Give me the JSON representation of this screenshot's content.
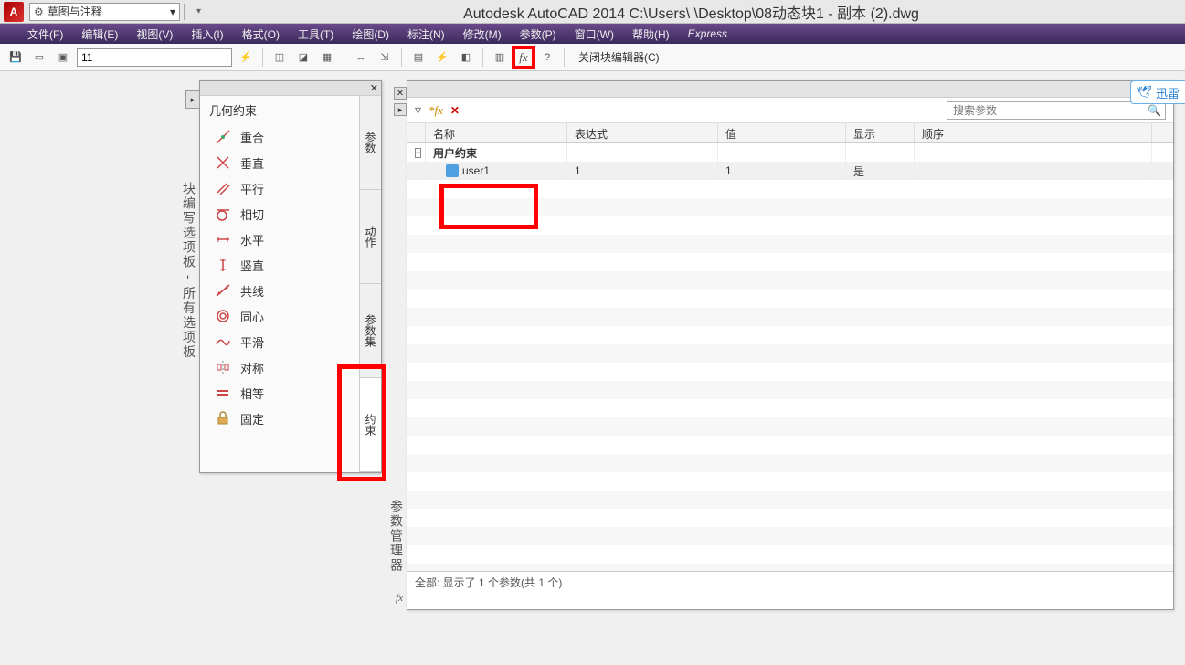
{
  "app": {
    "title": "Autodesk AutoCAD 2014    C:\\Users\\        \\Desktop\\08动态块1 - 副本 (2).dwg",
    "workspace": "草图与注释"
  },
  "menu": {
    "file": "文件(F)",
    "edit": "编辑(E)",
    "view": "视图(V)",
    "insert": "插入(I)",
    "format": "格式(O)",
    "tools": "工具(T)",
    "draw": "绘图(D)",
    "dim": "标注(N)",
    "modify": "修改(M)",
    "param": "参数(P)",
    "window": "窗口(W)",
    "help": "帮助(H)",
    "express": "Express"
  },
  "toolbar": {
    "input_value": "11",
    "close_editor": "关闭块编辑器(C)"
  },
  "palette": {
    "title": "块编写选项板 - 所有选项板",
    "section": "几何约束",
    "items": {
      "coincident": "重合",
      "perpendicular": "垂直",
      "parallel": "平行",
      "tangent": "相切",
      "horizontal": "水平",
      "vertical": "竖直",
      "collinear": "共线",
      "concentric": "同心",
      "smooth": "平滑",
      "symmetric": "对称",
      "equal": "相等",
      "fix": "固定"
    },
    "tabs": {
      "params": "参数",
      "actions": "动作",
      "paramsets": "参数集",
      "constraints": "约束"
    }
  },
  "params": {
    "title": "参数管理器",
    "search_placeholder": "搜索参数",
    "columns": {
      "name": "名称",
      "expr": "表达式",
      "value": "值",
      "show": "显示",
      "order": "顺序"
    },
    "group": "用户约束",
    "row1": {
      "name": "user1",
      "expr": "1",
      "value": "1",
      "show": "是"
    },
    "footer": "全部: 显示了 1 个参数(共 1 个)"
  },
  "xunlei": "迅雷"
}
